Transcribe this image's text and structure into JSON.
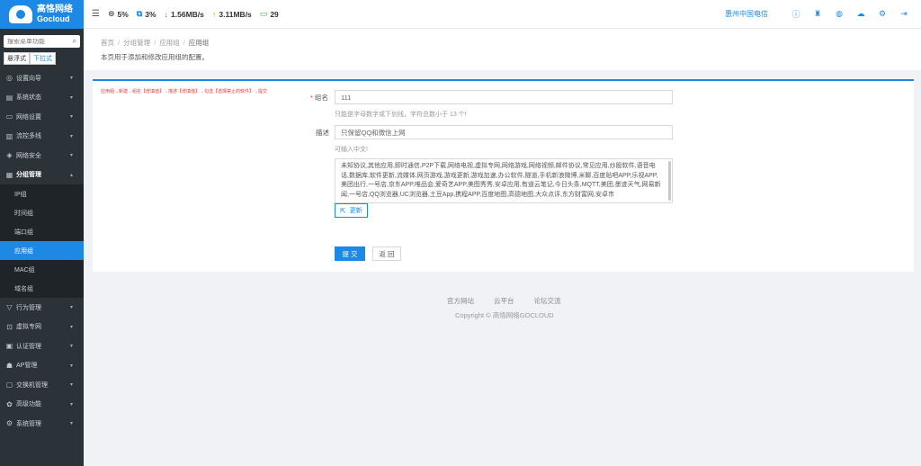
{
  "brand": {
    "name_cn": "高恪网络",
    "name_en": "Gocloud"
  },
  "sidebar": {
    "search_placeholder": "搜索菜单功能",
    "mode_hover": "悬浮式",
    "mode_dropdown": "下拉式",
    "items_top": [
      {
        "label": "设置向导",
        "icon": "◎",
        "arrow": "▾"
      },
      {
        "label": "系统状态",
        "icon": "▤",
        "arrow": "▾"
      },
      {
        "label": "网络设置",
        "icon": "▭",
        "arrow": "▾"
      },
      {
        "label": "流控多线",
        "icon": "▥",
        "arrow": "▾"
      },
      {
        "label": "网络安全",
        "icon": "◈",
        "arrow": "▾"
      }
    ],
    "open_item": {
      "label": "分组管理",
      "icon": "▦",
      "arrow": "▴"
    },
    "sub_items": [
      "IP组",
      "时间组",
      "端口组",
      "应用组",
      "MAC组",
      "域名组"
    ],
    "active_sub": "应用组",
    "items_bottom": [
      {
        "label": "行为管理",
        "icon": "▽",
        "arrow": "▾"
      },
      {
        "label": "虚拟专网",
        "icon": "⊡",
        "arrow": "▾"
      },
      {
        "label": "认证管理",
        "icon": "▣",
        "arrow": "▾"
      },
      {
        "label": "AP管理",
        "icon": "☗",
        "arrow": "▾"
      },
      {
        "label": "交换机管理",
        "icon": "▢",
        "arrow": "▾"
      },
      {
        "label": "高级功能",
        "icon": "✿",
        "arrow": "▾"
      },
      {
        "label": "系统管理",
        "icon": "⚙",
        "arrow": "▾"
      }
    ]
  },
  "topbar": {
    "cpu": "5%",
    "mem": "3%",
    "down": "1.56MB/s",
    "up": "3.11MB/s",
    "online": "29",
    "isp": "惠州中国电信"
  },
  "colors": {
    "accent": "#1e88e5",
    "down": "#43a047",
    "up": "#fb8c00",
    "hint": "#e53935"
  },
  "breadcrumb": [
    "首页",
    "分组管理",
    "应用组",
    "应用组"
  ],
  "page_desc": "本页用于添加和修改应用组的配置。",
  "form": {
    "hint": "应用组→新建→组名【增填值】→描述【增填值】→勾选【选择禁止的软件】→提交",
    "name_label": "组名",
    "name_value": "111",
    "name_help": "只能是字母数字或下划线，字符总数小于 13 个!",
    "desc_label": "描述",
    "desc_value": "只保留QQ和微信上网",
    "desc_help": "可输入中文!",
    "apps_text": "未知协议,其他应用,即时通信,P2P下载,网络电视,虚拟专网,网络游戏,网络视频,邮件协议,常见应用,炒股软件,语音电话,数据库,软件更新,流媒体,网页游戏,游戏更新,游戏加速,办公软件,隧道,手机新浪微博,米聊,百度贴吧APP,乐视APP,美团出行,一号店,京东APP,唯品会,爱奇艺APP,美图秀秀,安卓应用,有道云笔记,今日头条,MQTT,美团,墨迹天气,网易新闻,一号店,QQ浏览器,UC浏览器,土豆App,携程APP,百度地图,高德地图,大众点评,东方财富网,安卓市",
    "update_label": "更新",
    "submit_label": "提 交",
    "back_label": "返 回"
  },
  "footer": {
    "links": [
      "官方网站",
      "云平台",
      "论坛交流"
    ],
    "copyright": "Copyright © 高恪网络GOCLOUD"
  }
}
